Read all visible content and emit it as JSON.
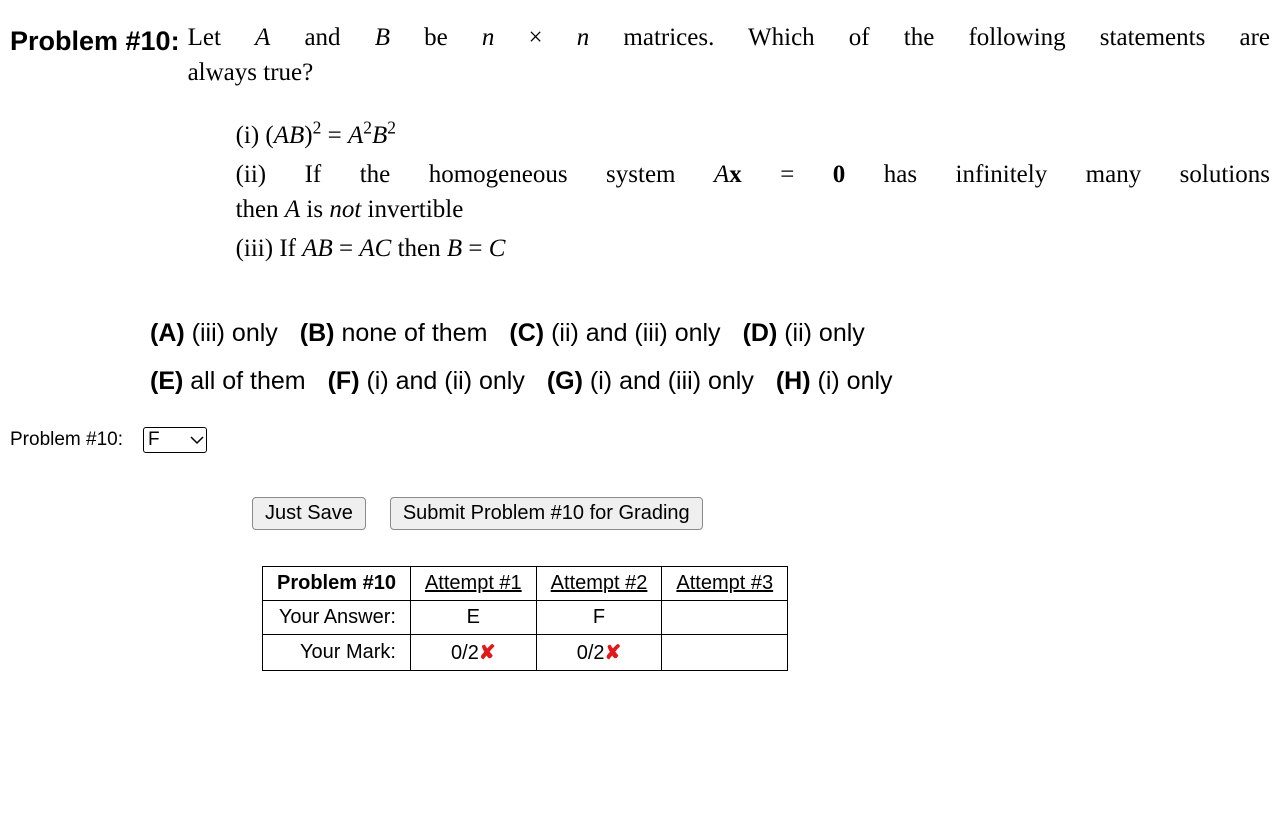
{
  "problem": {
    "number_label": "Problem #10:",
    "question_line1": "Let A and B be n × n matrices. Which of the following statements are",
    "question_line2": "always true?",
    "statements": {
      "i": "(i) (AB)² = A²B²",
      "ii_line1": "(ii) If the homogeneous system Ax = 0 has infinitely many solutions",
      "ii_line2": "then A is not invertible",
      "iii": "(iii) If AB = AC then B = C"
    },
    "options": {
      "A": "(A) (iii) only",
      "B": "(B) none of them",
      "C": "(C) (ii) and (iii) only",
      "D": "(D) (ii) only",
      "E": "(E) all of them",
      "F": "(F) (i) and (ii) only",
      "G": "(G) (i) and (iii) only",
      "H": "(H) (i) only"
    }
  },
  "answer": {
    "label": "Problem #10:",
    "selected": "F"
  },
  "buttons": {
    "just_save": "Just Save",
    "submit": "Submit Problem #10 for Grading"
  },
  "results": {
    "header_problem": "Problem #10",
    "attempts": [
      "Attempt #1",
      "Attempt #2",
      "Attempt #3"
    ],
    "your_answer_label": "Your Answer:",
    "your_mark_label": "Your Mark:",
    "answers": [
      "E",
      "F",
      ""
    ],
    "marks": [
      {
        "score": "0/2",
        "wrong": true
      },
      {
        "score": "0/2",
        "wrong": true
      },
      {
        "score": "",
        "wrong": false
      }
    ]
  }
}
